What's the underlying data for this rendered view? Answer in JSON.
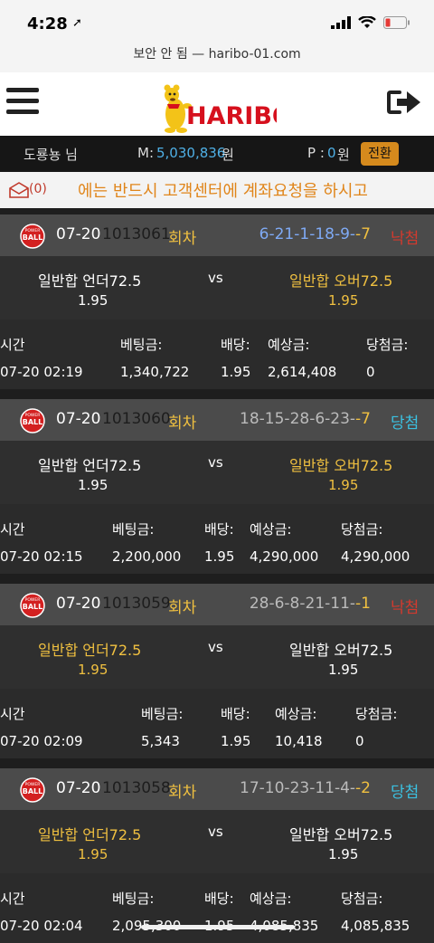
{
  "status": {
    "time": "4:28"
  },
  "url": "보안 안 됨 — haribo-01.com",
  "brand": {
    "logo_text": "HARIBO"
  },
  "user": {
    "name": "도룡뇽 님",
    "money_label": "M:",
    "money_value": "5,030,836",
    "money_unit": "원",
    "point_label": "P :",
    "point_value": "0",
    "point_unit": "원",
    "switch_label": "전환"
  },
  "notice": {
    "mail_count": "(0)",
    "marquee": "에는 반드시 고객센터에 계좌요청을 하시고"
  },
  "bet_headers": {
    "time": "시간",
    "amount": "베팅금:",
    "rate": "배당:",
    "expected": "예상금:",
    "won": "당첨금:"
  },
  "vs_label": "vs",
  "bets": [
    {
      "date": "07-20",
      "round": "1013061",
      "round_label": "회차",
      "result_nums": "6-21-1-18-9-",
      "result_last": "-7",
      "status": "낙첨",
      "left_option": "일반합 언더72.5",
      "right_option": "일반합 오버72.5",
      "left_odds": "1.95",
      "right_odds": "1.95",
      "selected": "right",
      "time": "07-20 02:19",
      "amount": "1,340,722",
      "rate": "1.95",
      "expected": "2,614,408",
      "won": "0"
    },
    {
      "date": "07-20",
      "round": "1013060",
      "round_label": "회차",
      "result_nums": "18-15-28-6-23-",
      "result_last": "-7",
      "status": "당첨",
      "left_option": "일반합 언더72.5",
      "right_option": "일반합 오버72.5",
      "left_odds": "1.95",
      "right_odds": "1.95",
      "selected": "right",
      "time": "07-20 02:15",
      "amount": "2,200,000",
      "rate": "1.95",
      "expected": "4,290,000",
      "won": "4,290,000"
    },
    {
      "date": "07-20",
      "round": "1013059",
      "round_label": "회차",
      "result_nums": "28-6-8-21-11-",
      "result_last": "-1",
      "status": "낙첨",
      "left_option": "일반합 언더72.5",
      "right_option": "일반합 오버72.5",
      "left_odds": "1.95",
      "right_odds": "1.95",
      "selected": "left",
      "time": "07-20 02:09",
      "amount": "5,343",
      "rate": "1.95",
      "expected": "10,418",
      "won": "0"
    },
    {
      "date": "07-20",
      "round": "1013058",
      "round_label": "회차",
      "result_nums": "17-10-23-11-4-",
      "result_last": "-2",
      "status": "당첨",
      "left_option": "일반합 언더72.5",
      "right_option": "일반합 오버72.5",
      "left_odds": "1.95",
      "right_odds": "1.95",
      "selected": "left",
      "time": "07-20 02:04",
      "amount": "2,095,300",
      "rate": "1.95",
      "expected": "4,085,835",
      "won": "4,085,835"
    }
  ],
  "colors": {
    "accent": "#f0c040",
    "win": "#3bc0e0",
    "lose": "#d23a2e",
    "switch_button": "#d58a1d",
    "logo_red": "#d6101d"
  }
}
